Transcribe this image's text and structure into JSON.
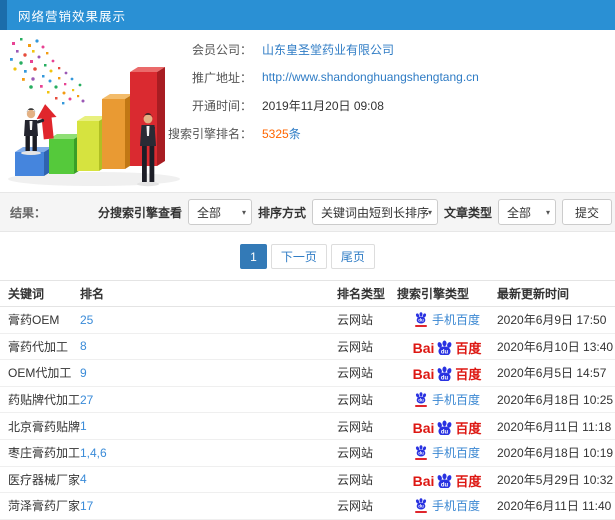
{
  "header": {
    "title": "网络营销效果展示"
  },
  "info": {
    "rows": [
      {
        "label": "会员公司：",
        "value": "山东皇圣堂药业有限公司"
      },
      {
        "label": "推广地址：",
        "value": "http://www.shandonghuangshengtang.cn"
      },
      {
        "label": "开通时间：",
        "value": "2019年11月20日 09:08"
      },
      {
        "label": "搜索引擎排名：",
        "value_number": "5325",
        "value_suffix": "条"
      }
    ]
  },
  "filters": {
    "result_label": "结果：",
    "engine_label": "分搜索引擎查看",
    "engine_value": "全部",
    "sort_label": "排序方式",
    "sort_value": "关键词由短到长排序",
    "article_label": "文章类型",
    "article_value": "全部",
    "submit_label": "提交",
    "caret": "▾"
  },
  "pagination": {
    "current": "1",
    "next": "下一页",
    "last": "尾页"
  },
  "engines": {
    "baidu_prefix": "Bai",
    "baidu_suffix": "百度",
    "mobile_label": "手机百度",
    "paw_text": "du"
  },
  "table": {
    "headers": [
      "关键词",
      "排名",
      "排名类型",
      "搜索引擎类型",
      "最新更新时间"
    ],
    "rows": [
      {
        "keyword": "膏药OEM",
        "rank": "25",
        "rank_type": "云网站",
        "engine": "mobile",
        "updated": "2020年6月9日 17:50"
      },
      {
        "keyword": "膏药代加工",
        "rank": "8",
        "rank_type": "云网站",
        "engine": "baidu",
        "updated": "2020年6月10日 13:40"
      },
      {
        "keyword": "OEM代加工",
        "rank": "9",
        "rank_type": "云网站",
        "engine": "baidu",
        "updated": "2020年6月5日 14:57"
      },
      {
        "keyword": "药贴牌代加工",
        "rank": "27",
        "rank_type": "云网站",
        "engine": "mobile",
        "updated": "2020年6月18日 10:25"
      },
      {
        "keyword": "北京膏药贴牌",
        "rank": "1",
        "rank_type": "云网站",
        "engine": "baidu",
        "updated": "2020年6月11日 11:18"
      },
      {
        "keyword": "枣庄膏药加工",
        "rank": "1,4,6",
        "rank_type": "云网站",
        "engine": "mobile",
        "updated": "2020年6月18日 10:19"
      },
      {
        "keyword": "医疗器械厂家",
        "rank": "4",
        "rank_type": "云网站",
        "engine": "baidu",
        "updated": "2020年5月29日 10:32"
      },
      {
        "keyword": "菏泽膏药厂家",
        "rank": "17",
        "rank_type": "云网站",
        "engine": "mobile",
        "updated": "2020年6月11日 11:40"
      }
    ]
  },
  "colors": {
    "header_blue": "#2a90d4",
    "header_accent": "#1b6dab",
    "link_blue": "#2f7cc5",
    "highlight_orange": "#ff6600",
    "baidu_red": "#dd1712",
    "baidu_blue": "#2932e1",
    "pagination_active_blue": "#337ab7",
    "filter_bar_gray": "#f5f5f5"
  }
}
